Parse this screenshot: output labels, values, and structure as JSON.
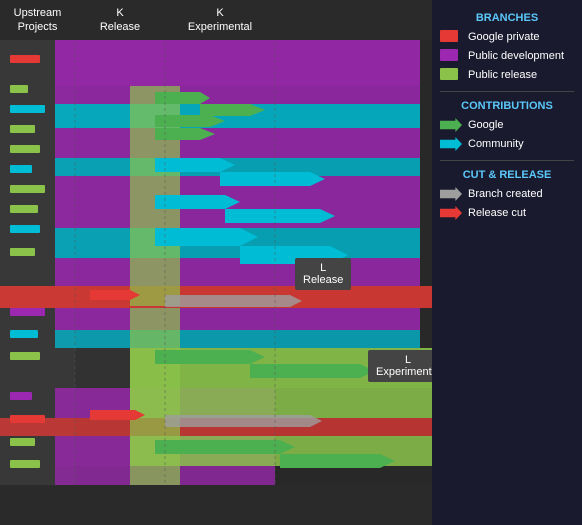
{
  "header": {
    "col_upstream": "Upstream\nProjects",
    "col_k_release": "K\nRelease",
    "col_k_experimental": "K\nExperimental",
    "col_l_release": "L\nRelease"
  },
  "legend": {
    "branches_title": "BRANCHES",
    "items_branches": [
      {
        "label": "Google private",
        "color": "#e53935"
      },
      {
        "label": "Public development",
        "color": "#9c27b0"
      },
      {
        "label": "Public release",
        "color": "#8bc34a"
      }
    ],
    "contributions_title": "CONTRIBUTIONS",
    "items_contributions": [
      {
        "label": "Google",
        "color": "#4caf50"
      },
      {
        "label": "Community",
        "color": "#00bcd4"
      }
    ],
    "cut_release_title": "CUT & RELEASE",
    "items_cut": [
      {
        "label": "Branch created",
        "color": "#9e9e9e"
      },
      {
        "label": "Release cut",
        "color": "#e53935"
      }
    ]
  },
  "tooltips": {
    "l_release": "L\nRelease",
    "l_experimental": "L\nExperimental"
  }
}
